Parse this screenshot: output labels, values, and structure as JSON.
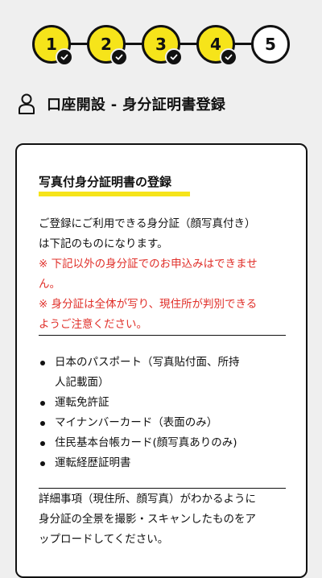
{
  "stepper": {
    "steps": [
      {
        "number": "1",
        "state": "done"
      },
      {
        "number": "2",
        "state": "done"
      },
      {
        "number": "3",
        "state": "done"
      },
      {
        "number": "4",
        "state": "done"
      },
      {
        "number": "5",
        "state": "current"
      }
    ],
    "colors": {
      "done": "#f6e41a",
      "current": "#ffffff",
      "border": "#111111"
    }
  },
  "page": {
    "title": "口座開設 - 身分証明書登録",
    "icon": "user-icon"
  },
  "card": {
    "section_title": "写真付身分証明書の登録",
    "intro_line1": "ご登録にご利用できる身分証（顔写真付き）",
    "intro_line2": "は下記のものになります。",
    "note1_line1": "※ 下記以外の身分証でのお申込みはできませ",
    "note1_line2": "ん。",
    "note2_line1": "※ 身分証は全体が写り、現住所が判別できる",
    "note2_line2": "ようご注意ください。",
    "documents": [
      {
        "line1": "日本のパスポート（写真貼付面、所持",
        "line2": "人記載面）"
      },
      {
        "line1": "運転免許証",
        "line2": ""
      },
      {
        "line1": "マイナンバーカード（表面のみ）",
        "line2": ""
      },
      {
        "line1": "住民基本台帳カード(顔写真ありのみ)",
        "line2": ""
      },
      {
        "line1": "運転経歴証明書",
        "line2": ""
      }
    ],
    "detail_line1": "詳細事項（現住所、顔写真）がわかるように",
    "detail_line2": "身分証の全景を撮影・スキャンしたものをア",
    "detail_line3": "ップロードしてください。"
  },
  "colors": {
    "accent": "#f6e41a",
    "warning": "#e0302a",
    "background": "#efefef"
  }
}
